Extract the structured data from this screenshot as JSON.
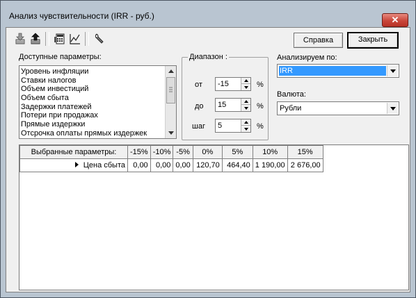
{
  "window": {
    "title": "Анализ чувствительности (IRR - руб.)",
    "close_glyph": "✕"
  },
  "toolbar": {
    "icons": [
      "import-down-icon",
      "export-up-icon",
      "calculator-icon",
      "chart-icon",
      "wrench-icon"
    ]
  },
  "buttons": {
    "help": "Справка",
    "close": "Закрыть"
  },
  "available_params": {
    "label": "Доступные параметры:",
    "items": [
      "Уровень инфляции",
      "Ставки налогов",
      "Объем инвестиций",
      "Объем сбыта",
      "Задержки платежей",
      "Потери при продажах",
      "Прямые издержки",
      "Отсрочка оплаты прямых издержек"
    ]
  },
  "range": {
    "title": "Диапазон :",
    "from_label": "от",
    "from_value": "-15",
    "to_label": "до",
    "to_value": "15",
    "step_label": "шаг",
    "step_value": "5",
    "unit": "%"
  },
  "analyze": {
    "label": "Анализируем по:",
    "value": "IRR"
  },
  "currency": {
    "label": "Валюта:",
    "value": "Рубли"
  },
  "grid": {
    "columns": [
      "Выбранные параметры:",
      "-15%",
      "-10%",
      "-5%",
      "0%",
      "5%",
      "10%",
      "15%"
    ],
    "rows": [
      {
        "name": "Цена сбыта",
        "values": [
          "0,00",
          "0,00",
          "0,00",
          "120,70",
          "464,40",
          "1 190,00",
          "2 676,00"
        ]
      }
    ]
  }
}
